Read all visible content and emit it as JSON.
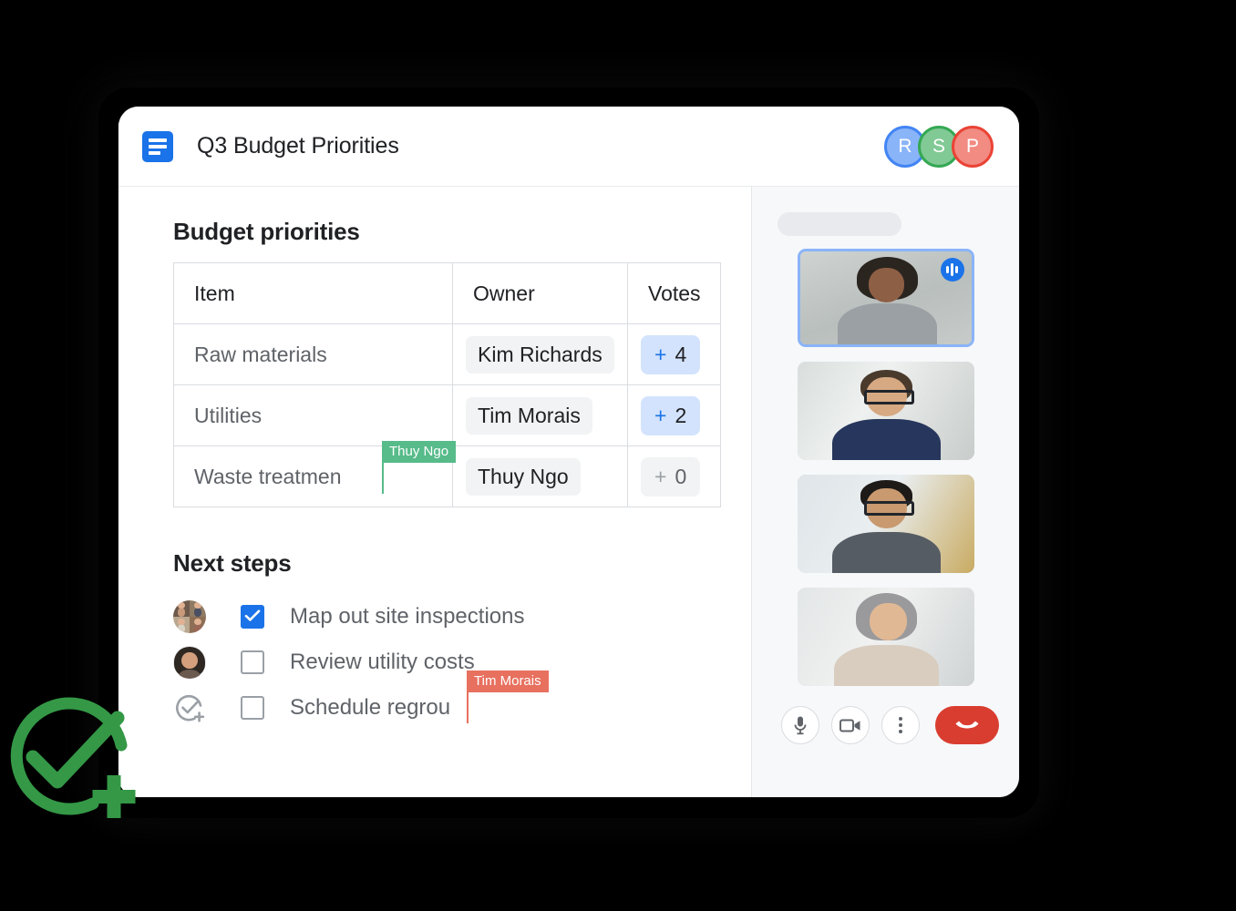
{
  "app": {
    "doc_icon": "docs-icon",
    "title": "Q3 Budget Priorities",
    "presence_avatars": [
      {
        "initial": "R",
        "color": "#4285f4",
        "name": "presence-avatar-r"
      },
      {
        "initial": "S",
        "color": "#34a853",
        "name": "presence-avatar-s"
      },
      {
        "initial": "P",
        "color": "#ea4335",
        "name": "presence-avatar-p"
      }
    ]
  },
  "document": {
    "sections": [
      {
        "heading": "Budget priorities"
      },
      {
        "heading": "Next steps"
      }
    ],
    "table": {
      "columns": [
        "Item",
        "Owner",
        "Votes"
      ],
      "rows": [
        {
          "item": "Raw materials",
          "owner": "Kim Richards",
          "votes": "4",
          "vote_plus": "+",
          "vote_state": "active"
        },
        {
          "item": "Utilities",
          "owner": "Tim Morais",
          "votes": "2",
          "vote_plus": "+",
          "vote_state": "active"
        },
        {
          "item": "Waste treatmen",
          "owner": "Thuy Ngo",
          "votes": "0",
          "vote_plus": "+",
          "vote_state": "zero"
        }
      ]
    },
    "tasks": [
      {
        "label": "Map out site inspections",
        "checked": true,
        "assignee_icon": "avatar-group"
      },
      {
        "label": "Review utility costs",
        "checked": false,
        "assignee_icon": "avatar-single"
      },
      {
        "label": "Schedule regrou",
        "checked": false,
        "assignee_icon": "assign-task-icon"
      }
    ],
    "collaborator_cursors": [
      {
        "name": "Thuy Ngo",
        "color": "#57bb8a",
        "location": "table-cell-waste-treatment"
      },
      {
        "name": "Tim Morais",
        "color": "#e8705f",
        "location": "task-schedule-regroup"
      }
    ]
  },
  "meet_panel": {
    "tiles": [
      {
        "participant_label": "participant-tile-1",
        "speaking": true,
        "active_speaker": true
      },
      {
        "participant_label": "participant-tile-2",
        "speaking": false,
        "active_speaker": false
      },
      {
        "participant_label": "participant-tile-3",
        "speaking": false,
        "active_speaker": false
      },
      {
        "participant_label": "participant-tile-4",
        "speaking": false,
        "active_speaker": false
      }
    ],
    "controls": [
      {
        "icon": "microphone-icon",
        "name": "mute-button"
      },
      {
        "icon": "video-camera-icon",
        "name": "camera-button"
      },
      {
        "icon": "more-options-icon",
        "name": "more-options-button"
      },
      {
        "icon": "phone-hangup-icon",
        "name": "leave-call-button"
      }
    ]
  },
  "decoration": {
    "badge_icon": "check-circle-plus-icon",
    "badge_color": "#349846"
  },
  "colors": {
    "accent_blue": "#1a73e8",
    "vote_chip_bg": "#d3e3fd",
    "chip_gray": "#f1f3f4",
    "hangup_red": "#d93d30",
    "cursor_green": "#57bb8a",
    "cursor_red": "#e8705f"
  }
}
